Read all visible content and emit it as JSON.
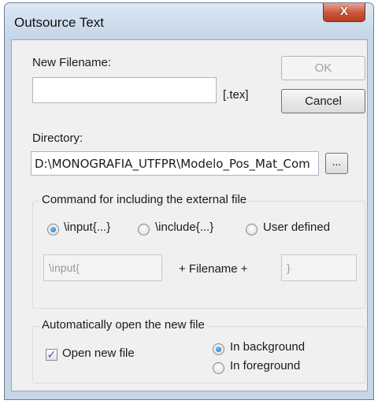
{
  "window": {
    "title": "Outsource Text",
    "close_glyph": "X"
  },
  "filename": {
    "label": "New Filename:",
    "value": "",
    "extension": "[.tex]"
  },
  "buttons": {
    "ok_label": "OK",
    "cancel_label": "Cancel",
    "browse_label": "..."
  },
  "directory": {
    "label": "Directory:",
    "value": "D:\\MONOGRAFIA_UTFPR\\Modelo_Pos_Mat_Com"
  },
  "command_group": {
    "title": "Command for including the external file",
    "options": [
      {
        "label": "\\input{...}",
        "checked": true
      },
      {
        "label": "\\include{...}",
        "checked": false
      },
      {
        "label": "User defined",
        "checked": false
      }
    ],
    "prefix_value": "\\input{",
    "middle_label": "+ Filename +",
    "suffix_value": "}"
  },
  "open_group": {
    "title": "Automatically open the new file",
    "open_new_file_label": "Open new file",
    "open_new_file_checked": true,
    "check_glyph": "✓",
    "options": [
      {
        "label": "In background",
        "checked": true
      },
      {
        "label": "In foreground",
        "checked": false
      }
    ]
  },
  "colors": {
    "window_frame": "#c7d6e6",
    "client_bg": "#f0f0f0",
    "close_button": "#c9533a",
    "radio_accent": "#1f6fb8"
  }
}
